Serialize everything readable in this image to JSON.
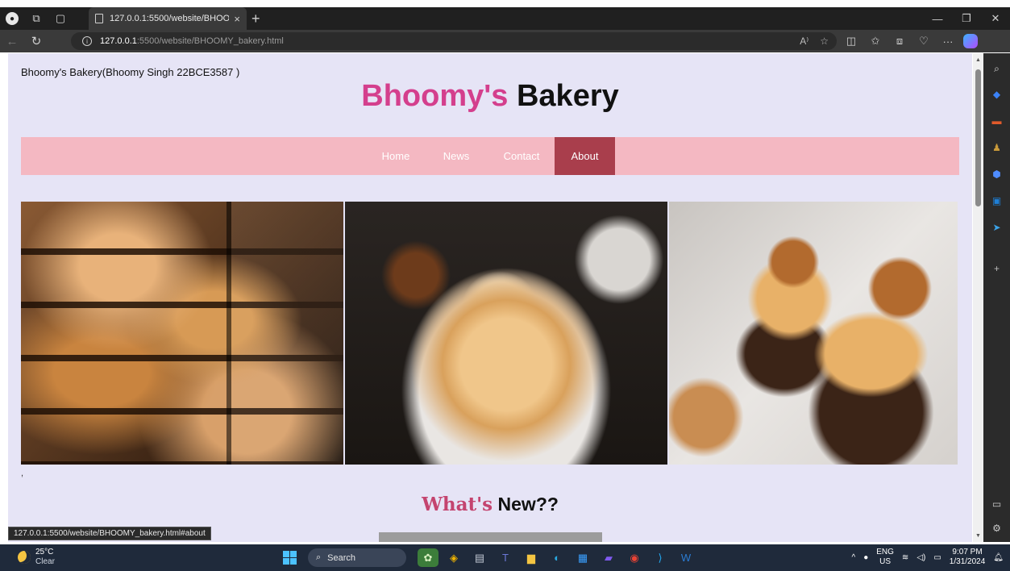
{
  "browser": {
    "tab_title": "127.0.0.1:5500/website/BHOOMY_bakery.html",
    "tab_close": "×",
    "new_tab": "+",
    "url_host": "127.0.0.1",
    "url_path": ":5500/website/BHOOMY_bakery.html",
    "status_link": "127.0.0.1:5500/website/BHOOMY_bakery.html#about"
  },
  "page": {
    "owner_line": "Bhoomy's Bakery(Bhoomy Singh 22BCE3587 )",
    "brand_pink": "Bhoomy's",
    "brand_black": "Bakery",
    "nav": [
      {
        "label": "Home"
      },
      {
        "label": "News"
      },
      {
        "label": "Contact"
      },
      {
        "label": "About"
      }
    ],
    "active_nav": "About",
    "stray_char": ",",
    "whats_new_pink": "What's",
    "whats_new_black": "New??"
  },
  "taskbar": {
    "temperature": "25°C",
    "weather": "Clear",
    "search_placeholder": "Search",
    "lang_top": "ENG",
    "lang_bottom": "US",
    "time": "9:07 PM",
    "date": "1/31/2024"
  },
  "colors": {
    "page_bg": "#e6e4f6",
    "brand_pink": "#d43f8d",
    "nav_bg": "#f4b8c2",
    "nav_active": "#a93e4c"
  }
}
